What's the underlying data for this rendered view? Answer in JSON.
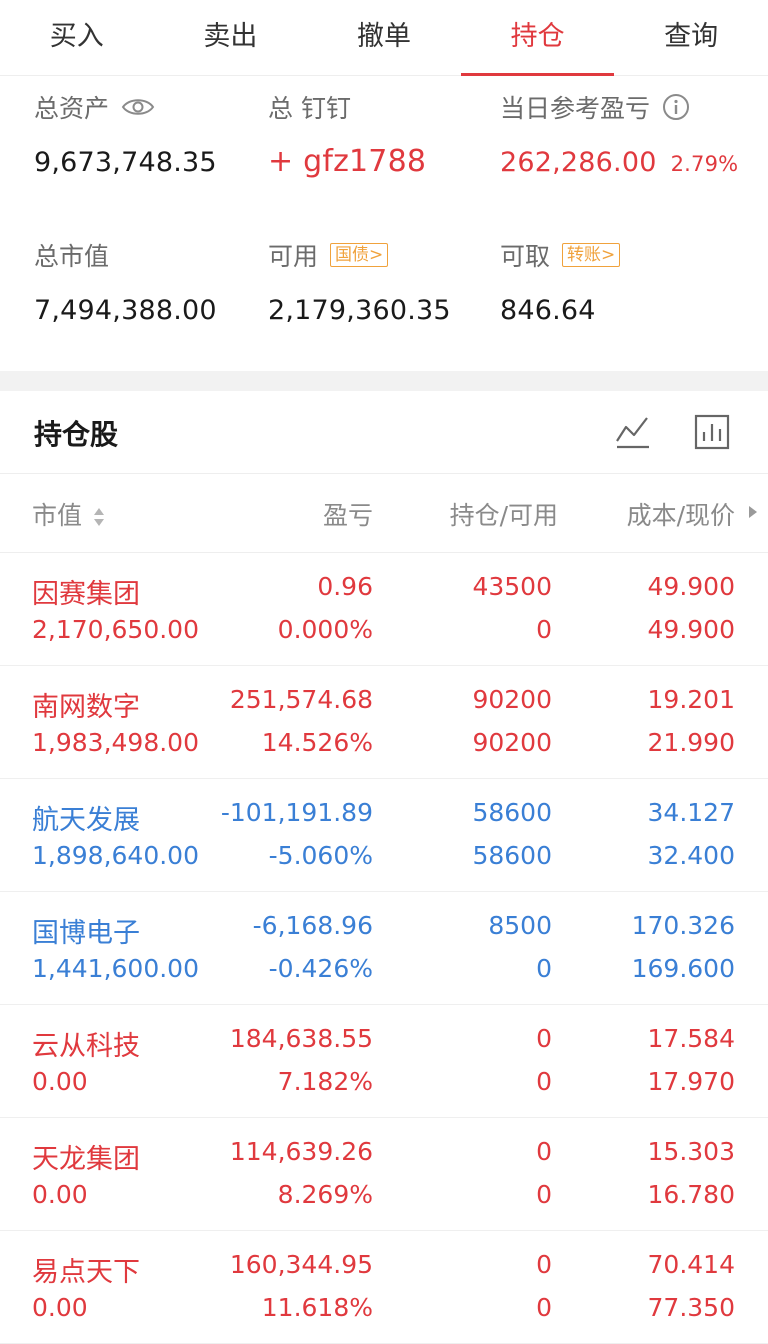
{
  "tabs": [
    {
      "label": "买入"
    },
    {
      "label": "卖出"
    },
    {
      "label": "撤单"
    },
    {
      "label": "持仓"
    },
    {
      "label": "查询"
    }
  ],
  "active_tab": "持仓",
  "summary": {
    "total_assets_label": "总资产",
    "total_assets_value": "9,673,748.35",
    "account_label": "总  钉钉",
    "account_value": "+ gfz1788",
    "daily_pl_label": "当日参考盈亏",
    "daily_pl_value": "262,286.00",
    "daily_pl_pct": "2.79%",
    "market_value_label": "总市值",
    "market_value_value": "7,494,388.00",
    "available_label": "可用",
    "available_tag": "国债>",
    "available_value": "2,179,360.35",
    "withdrawable_label": "可取",
    "withdrawable_tag": "转账>",
    "withdrawable_value": "846.64"
  },
  "holdings": {
    "title": "持仓股",
    "columns": [
      "市值",
      "盈亏",
      "持仓/可用",
      "成本/现价"
    ],
    "rows": [
      {
        "name": "因赛集团",
        "market_value": "2,170,650.00",
        "pl": "0.96",
        "pl_pct": "0.000%",
        "position": "43500",
        "available": "0",
        "cost": "49.900",
        "price": "49.900",
        "trend": "up"
      },
      {
        "name": "南网数字",
        "market_value": "1,983,498.00",
        "pl": "251,574.68",
        "pl_pct": "14.526%",
        "position": "90200",
        "available": "90200",
        "cost": "19.201",
        "price": "21.990",
        "trend": "up"
      },
      {
        "name": "航天发展",
        "market_value": "1,898,640.00",
        "pl": "-101,191.89",
        "pl_pct": "-5.060%",
        "position": "58600",
        "available": "58600",
        "cost": "34.127",
        "price": "32.400",
        "trend": "down"
      },
      {
        "name": "国博电子",
        "market_value": "1,441,600.00",
        "pl": "-6,168.96",
        "pl_pct": "-0.426%",
        "position": "8500",
        "available": "0",
        "cost": "170.326",
        "price": "169.600",
        "trend": "down"
      },
      {
        "name": "云从科技",
        "market_value": "0.00",
        "pl": "184,638.55",
        "pl_pct": "7.182%",
        "position": "0",
        "available": "0",
        "cost": "17.584",
        "price": "17.970",
        "trend": "up"
      },
      {
        "name": "天龙集团",
        "market_value": "0.00",
        "pl": "114,639.26",
        "pl_pct": "8.269%",
        "position": "0",
        "available": "0",
        "cost": "15.303",
        "price": "16.780",
        "trend": "up"
      },
      {
        "name": "易点天下",
        "market_value": "0.00",
        "pl": "160,344.95",
        "pl_pct": "11.618%",
        "position": "0",
        "available": "0",
        "cost": "70.414",
        "price": "77.350",
        "trend": "up"
      }
    ]
  },
  "icons": {
    "eye": "eye-icon",
    "info": "info-icon",
    "line_chart": "line-chart-icon",
    "bar_chart": "bar-chart-icon",
    "sort": "sort-icon",
    "more": "caret-right-icon"
  },
  "colors": {
    "accent": "#e0393e",
    "up": "#e0393e",
    "down": "#3a7fd5",
    "tag": "#f0a23c"
  }
}
